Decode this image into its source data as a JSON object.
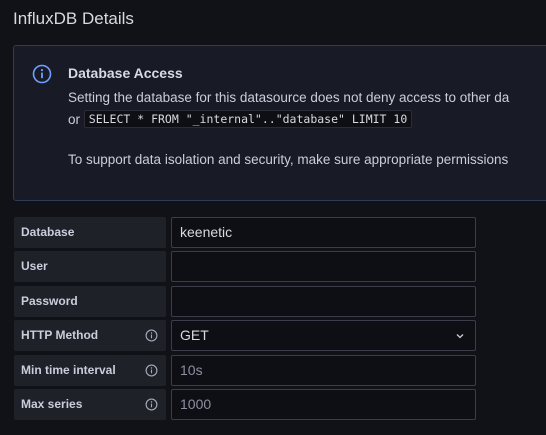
{
  "section": {
    "title": "InfluxDB Details"
  },
  "alert": {
    "icon": "info-circle-icon",
    "title": "Database Access",
    "line1": "Setting the database for this datasource does not deny access to other da",
    "line2_prefix": "or ",
    "line2_code": "SELECT * FROM \"_internal\"..\"database\" LIMIT 10",
    "line3": "To support data isolation and security, make sure appropriate permissions",
    "accent_color": "#6e9fff"
  },
  "form": {
    "database": {
      "label": "Database",
      "value": "keenetic"
    },
    "user": {
      "label": "User",
      "value": ""
    },
    "password": {
      "label": "Password",
      "value": ""
    },
    "http_method": {
      "label": "HTTP Method",
      "value": "GET",
      "info_icon": "info-circle-icon",
      "chevron_icon": "chevron-down-icon"
    },
    "min_time_interval": {
      "label": "Min time interval",
      "placeholder": "10s",
      "info_icon": "info-circle-icon"
    },
    "max_series": {
      "label": "Max series",
      "placeholder": "1000",
      "info_icon": "info-circle-icon"
    }
  }
}
